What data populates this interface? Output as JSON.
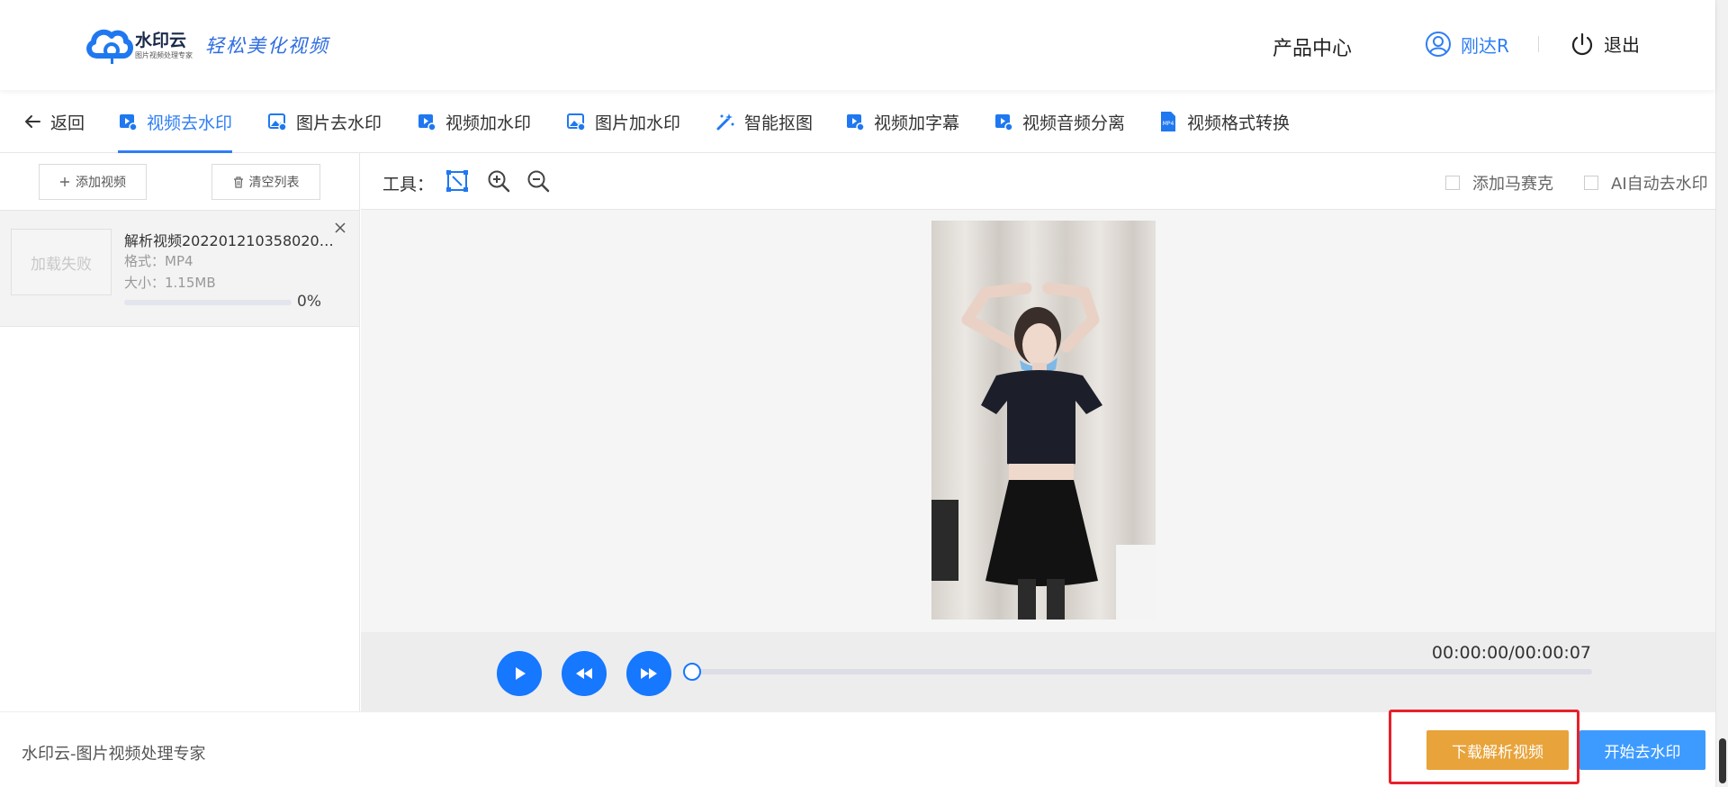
{
  "header": {
    "logo_name": "水印云",
    "logo_sub": "图片视频处理专家",
    "slogan": "轻松美化视频",
    "product_center": "产品中心",
    "username": "刚达R",
    "logout": "退出"
  },
  "tabs": {
    "back": "返回",
    "items": [
      {
        "label": "视频去水印",
        "icon": "video-icon",
        "active": true
      },
      {
        "label": "图片去水印",
        "icon": "image-icon",
        "active": false
      },
      {
        "label": "视频加水印",
        "icon": "video-icon",
        "active": false
      },
      {
        "label": "图片加水印",
        "icon": "image-icon",
        "active": false
      },
      {
        "label": "智能抠图",
        "icon": "magic-wand-icon",
        "active": false
      },
      {
        "label": "视频加字幕",
        "icon": "video-icon",
        "active": false
      },
      {
        "label": "视频音频分离",
        "icon": "video-icon",
        "active": false
      },
      {
        "label": "视频格式转换",
        "icon": "mp4-file-icon",
        "active": false
      }
    ]
  },
  "sidebar": {
    "add_video": "添加视频",
    "clear_list": "清空列表",
    "files": [
      {
        "thumb_text": "加载失败",
        "name": "解析视频20220121035802013...",
        "format": "格式：MP4",
        "size": "大小：1.15MB",
        "progress": 0,
        "progress_text": "0%"
      }
    ]
  },
  "toolbar": {
    "label": "工具：",
    "options": {
      "mosaic": "添加马赛克",
      "ai_remove": "AI自动去水印"
    }
  },
  "player": {
    "time": "00:00:00/00:00:07",
    "position": 0
  },
  "footer": {
    "brand": "水印云-图片视频处理专家",
    "download": "下载解析视频",
    "start": "开始去水印"
  },
  "colors": {
    "accent": "#2f7ef5",
    "download": "#e8a33a",
    "start": "#3d9bff",
    "highlight": "#e8202a"
  }
}
